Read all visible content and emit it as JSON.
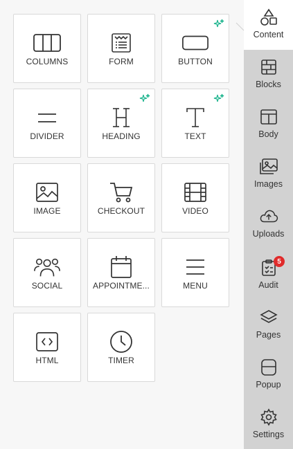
{
  "accent_colors": {
    "sparkle": "#1fb58f",
    "badge": "#e02b2b",
    "sidebar_bg": "#d2d2d2"
  },
  "tiles": [
    {
      "label": "COLUMNS",
      "icon": "columns-icon",
      "ai": false
    },
    {
      "label": "FORM",
      "icon": "form-icon",
      "ai": false
    },
    {
      "label": "BUTTON",
      "icon": "button-icon",
      "ai": true
    },
    {
      "label": "DIVIDER",
      "icon": "divider-icon",
      "ai": false
    },
    {
      "label": "HEADING",
      "icon": "heading-icon",
      "ai": true
    },
    {
      "label": "TEXT",
      "icon": "text-icon",
      "ai": true
    },
    {
      "label": "IMAGE",
      "icon": "image-icon",
      "ai": false
    },
    {
      "label": "CHECKOUT",
      "icon": "cart-icon",
      "ai": false
    },
    {
      "label": "VIDEO",
      "icon": "video-icon",
      "ai": false
    },
    {
      "label": "SOCIAL",
      "icon": "people-icon",
      "ai": false
    },
    {
      "label": "APPOINTME...",
      "icon": "calendar-icon",
      "ai": false
    },
    {
      "label": "MENU",
      "icon": "menu-icon",
      "ai": false
    },
    {
      "label": "HTML",
      "icon": "code-icon",
      "ai": false
    },
    {
      "label": "TIMER",
      "icon": "clock-icon",
      "ai": false
    }
  ],
  "sidebar": {
    "items": [
      {
        "label": "Content",
        "icon": "shapes-icon",
        "active": true
      },
      {
        "label": "Blocks",
        "icon": "blocks-icon",
        "active": false
      },
      {
        "label": "Body",
        "icon": "body-layout-icon",
        "active": false
      },
      {
        "label": "Images",
        "icon": "images-icon",
        "active": false
      },
      {
        "label": "Uploads",
        "icon": "cloud-upload-icon",
        "active": false
      },
      {
        "label": "Audit",
        "icon": "clipboard-check-icon",
        "active": false,
        "badge": "5"
      },
      {
        "label": "Pages",
        "icon": "layers-icon",
        "active": false
      },
      {
        "label": "Popup",
        "icon": "popup-icon",
        "active": false
      },
      {
        "label": "Settings",
        "icon": "gear-icon",
        "active": false
      }
    ]
  }
}
